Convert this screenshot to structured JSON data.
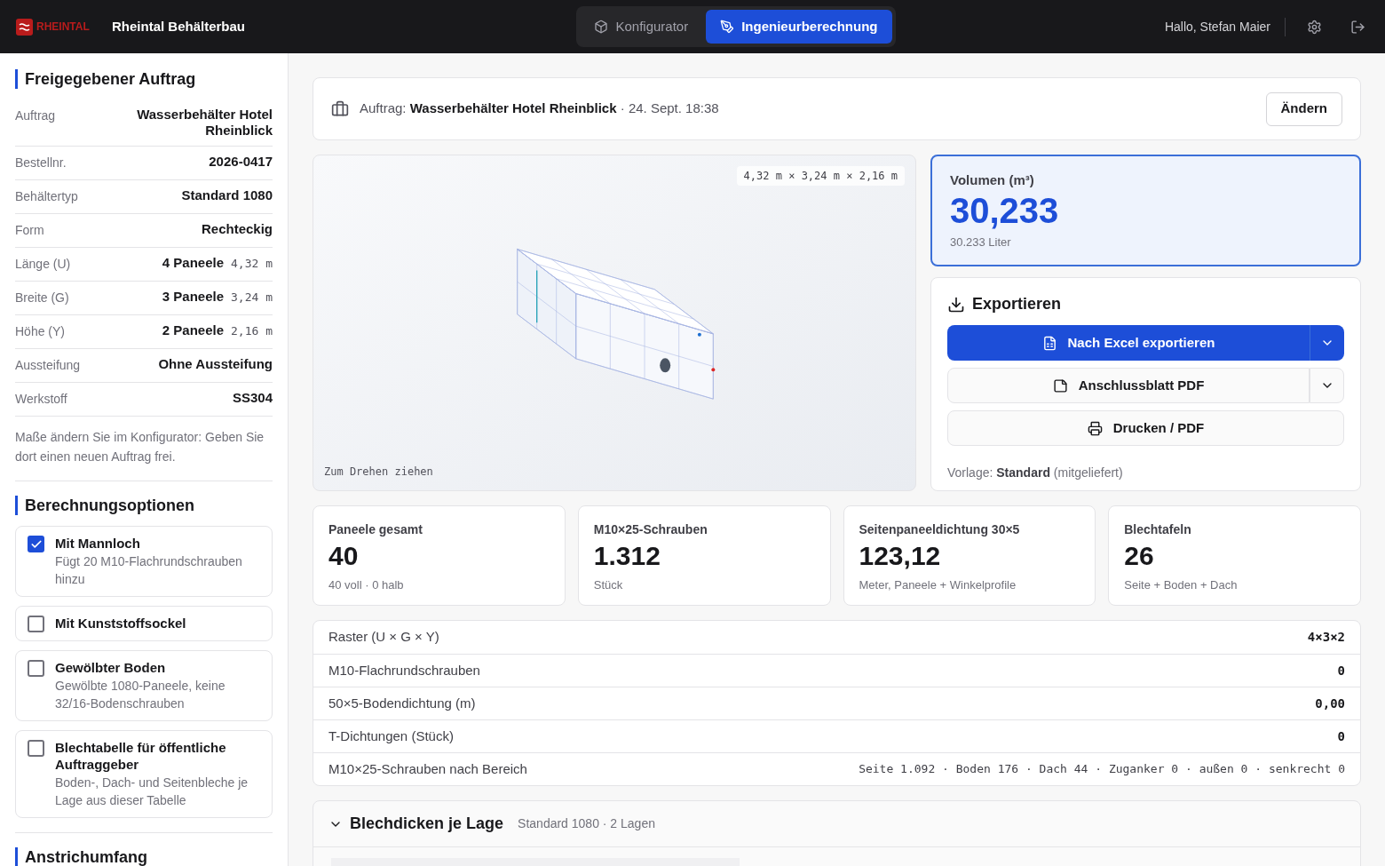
{
  "header": {
    "logo_text": "RHEINTAL",
    "company": "Rheintal Behälterbau",
    "tabs": [
      {
        "label": "Konfigurator",
        "selected": false
      },
      {
        "label": "Ingenieurberechnung",
        "selected": true
      }
    ],
    "greeting": "Hallo, Stefan Maier"
  },
  "sidebar": {
    "order_title": "Freigegebener Auftrag",
    "details": [
      {
        "label": "Auftrag",
        "value": "Wasserbehälter Hotel Rheinblick"
      },
      {
        "label": "Bestellnr.",
        "value": "2026-0417"
      },
      {
        "label": "Behältertyp",
        "value": "Standard 1080"
      },
      {
        "label": "Form",
        "value": "Rechteckig"
      },
      {
        "label": "Länge (U)",
        "value": "4 Paneele",
        "measure": "4,32 m"
      },
      {
        "label": "Breite (G)",
        "value": "3 Paneele",
        "measure": "3,24 m"
      },
      {
        "label": "Höhe (Y)",
        "value": "2 Paneele",
        "measure": "2,16 m"
      },
      {
        "label": "Aussteifung",
        "value": "Ohne Aussteifung"
      },
      {
        "label": "Werkstoff",
        "value": "SS304"
      }
    ],
    "note": "Maße ändern Sie im Konfigurator: Geben Sie dort einen neuen Auftrag frei.",
    "options_title": "Berechnungsoptionen",
    "options": [
      {
        "label": "Mit Mannloch",
        "hint": "Fügt 20 M10-Flachrundschrauben hinzu",
        "checked": true
      },
      {
        "label": "Mit Kunststoffsockel",
        "checked": false
      },
      {
        "label": "Gewölbter Boden",
        "hint": "Gewölbte 1080-Paneele, keine 32/16-Bodenschrauben",
        "checked": false
      },
      {
        "label": "Blechtabelle für öffentliche Auftraggeber",
        "hint": "Boden-, Dach- und Seitenbleche je Lage aus dieser Tabelle",
        "checked": false
      }
    ],
    "paint_title": "Anstrichumfang"
  },
  "order_bar": {
    "prefix": "Auftrag:",
    "name": "Wasserbehälter Hotel Rheinblick",
    "date": "· 24. Sept. 18:38",
    "button": "Ändern"
  },
  "viewer": {
    "dimensions": "4,32 m × 3,24 m × 2,16 m",
    "hint": "Zum Drehen ziehen"
  },
  "volume": {
    "label": "Volumen (m³)",
    "value": "30,233",
    "liters": "30.233 Liter"
  },
  "export": {
    "title": "Exportieren",
    "buttons": [
      {
        "label": "Nach Excel exportieren",
        "kind": "primary",
        "menu": true
      },
      {
        "label": "Anschlussblatt PDF",
        "kind": "secondary",
        "menu": true
      },
      {
        "label": "Drucken / PDF",
        "kind": "secondary",
        "menu": false
      }
    ],
    "template_prefix": "Vorlage:",
    "template_name": "Standard",
    "template_suffix": "(mitgeliefert)"
  },
  "stats": [
    {
      "label": "Paneele gesamt",
      "value": "40",
      "sub": "40 voll · 0 halb"
    },
    {
      "label": "M10×25-Schrauben",
      "value": "1.312",
      "sub": "Stück"
    },
    {
      "label": "Seitenpaneeldichtung 30×5",
      "value": "123,12",
      "sub": "Meter, Paneele + Winkelprofile"
    },
    {
      "label": "Blechtafeln",
      "value": "26",
      "sub": "Seite + Boden + Dach"
    }
  ],
  "summary": [
    {
      "label": "Raster (U × G × Y)",
      "value": "4×3×2"
    },
    {
      "label": "M10-Flachrundschrauben",
      "value": "0"
    },
    {
      "label": "50×5-Bodendichtung (m)",
      "value": "0,00"
    },
    {
      "label": "T-Dichtungen (Stück)",
      "value": "0"
    },
    {
      "label": "M10×25-Schrauben nach Bereich",
      "value": "Seite 1.092 · Boden 176 · Dach 44 · Zuganker 0 · außen 0 · senkrecht 0"
    }
  ],
  "thickness": {
    "title": "Blechdicken je Lage",
    "sub": "Standard 1080 · 2 Lagen",
    "expanded": true
  }
}
